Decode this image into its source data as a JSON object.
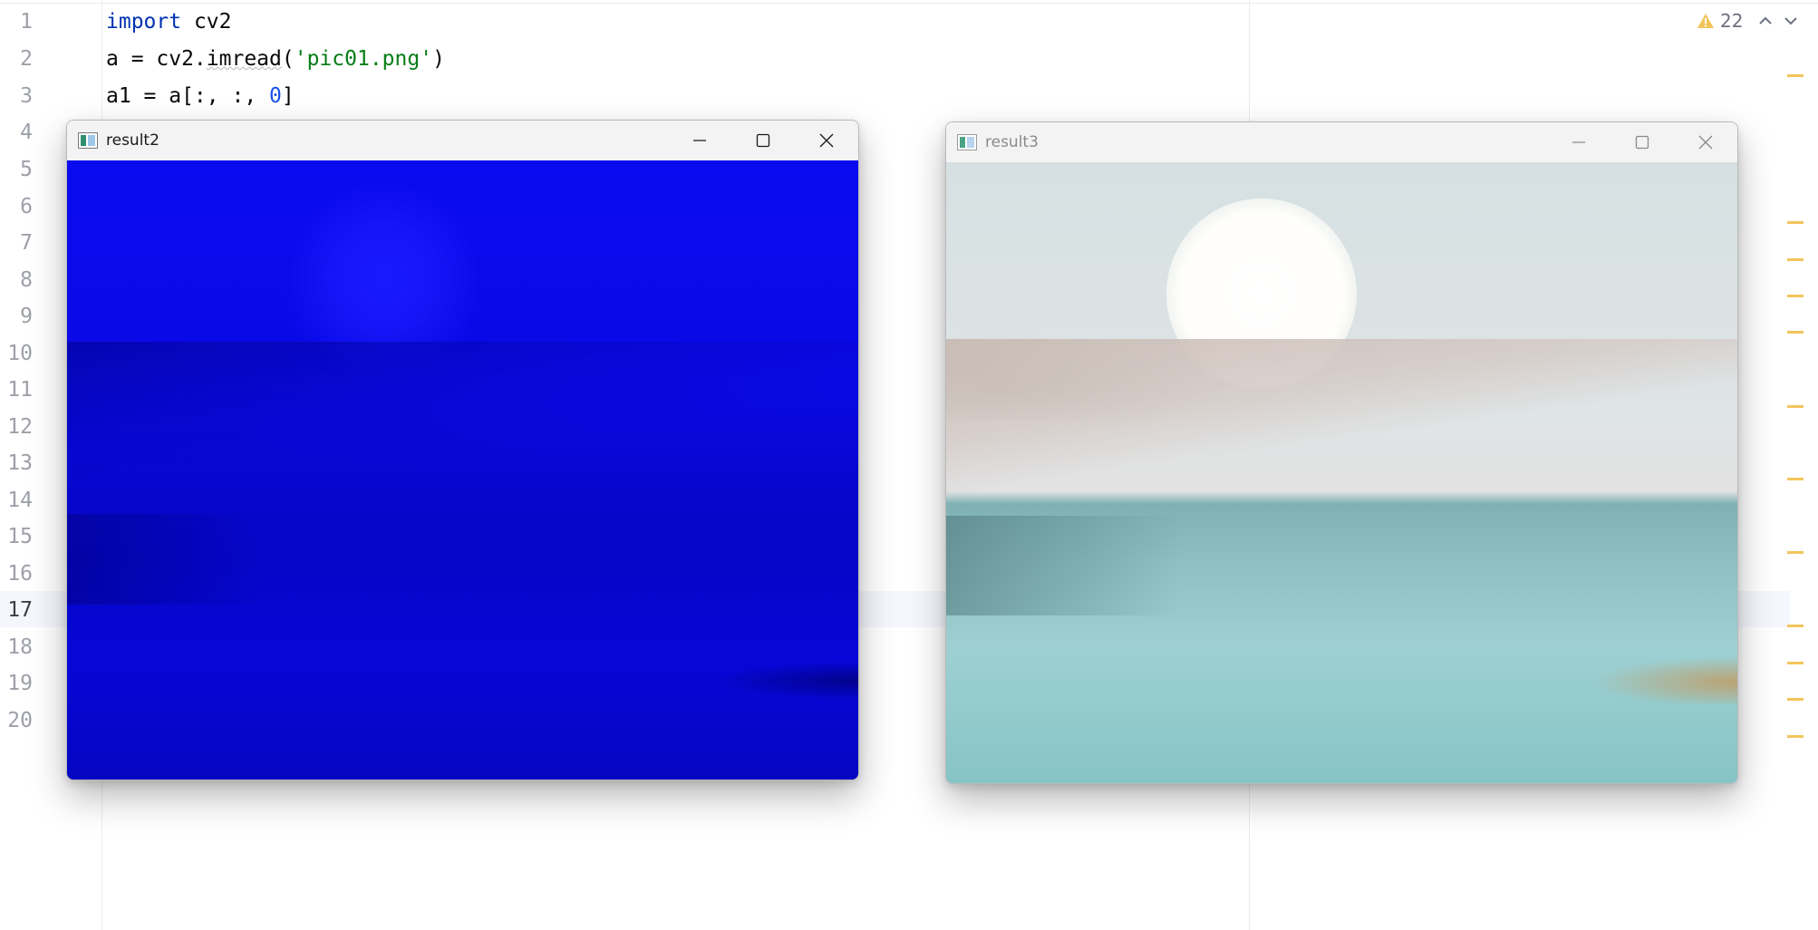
{
  "editor": {
    "line_numbers": [
      "1",
      "2",
      "3",
      "4",
      "5",
      "6",
      "7",
      "8",
      "9",
      "10",
      "11",
      "12",
      "13",
      "14",
      "15",
      "16",
      "17",
      "18",
      "19",
      "20"
    ],
    "current_line": "17",
    "code": {
      "line1": {
        "kw": "import",
        "rest": " cv2"
      },
      "line2": {
        "a": "a = cv2.",
        "fn": "imread",
        "b": "(",
        "str": "'pic01.png'",
        "c": ")"
      },
      "line3": {
        "a": "a1 = a[:, :, ",
        "num": "0",
        "b": "]"
      }
    },
    "inspections": {
      "warning_count": "22",
      "icons": [
        "warning-icon",
        "chevron-up-icon",
        "chevron-down-icon"
      ]
    },
    "colors": {
      "keyword": "#0033b3",
      "string": "#067d17",
      "number": "#1750eb",
      "warning": "#f2c55c"
    }
  },
  "windows": [
    {
      "title": "result2",
      "state": "active",
      "icons": [
        "app-window-icon",
        "minimize-icon",
        "maximize-icon",
        "close-icon"
      ]
    },
    {
      "title": "result3",
      "state": "inactive",
      "icons": [
        "app-window-icon",
        "minimize-icon",
        "maximize-icon",
        "close-icon"
      ]
    }
  ]
}
